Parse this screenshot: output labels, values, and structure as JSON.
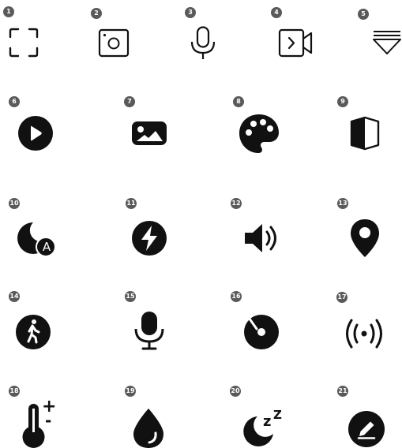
{
  "colors": {
    "icon": "#111111",
    "badge": "#5a5a5a",
    "background": "#ffffff"
  },
  "icons": [
    {
      "badge": "1",
      "name": "scan-frame-icon"
    },
    {
      "badge": "2",
      "name": "screenshot-camera-icon"
    },
    {
      "badge": "3",
      "name": "microphone-outline-icon"
    },
    {
      "badge": "4",
      "name": "screen-record-icon"
    },
    {
      "badge": "5",
      "name": "notification-shade-icon"
    },
    {
      "badge": "6",
      "name": "play-circle-icon"
    },
    {
      "badge": "7",
      "name": "image-icon"
    },
    {
      "badge": "8",
      "name": "palette-icon"
    },
    {
      "badge": "9",
      "name": "contrast-shield-icon"
    },
    {
      "badge": "10",
      "name": "auto-dark-mode-icon",
      "glyph": "A"
    },
    {
      "badge": "11",
      "name": "flash-circle-icon"
    },
    {
      "badge": "12",
      "name": "volume-icon"
    },
    {
      "badge": "13",
      "name": "location-pin-icon"
    },
    {
      "badge": "14",
      "name": "walking-person-icon"
    },
    {
      "badge": "15",
      "name": "microphone-icon"
    },
    {
      "badge": "16",
      "name": "music-disc-icon"
    },
    {
      "badge": "17",
      "name": "broadcast-signal-icon"
    },
    {
      "badge": "18",
      "name": "temperature-adjust-icon",
      "plus": "+",
      "minus": "-"
    },
    {
      "badge": "19",
      "name": "water-drop-icon"
    },
    {
      "badge": "20",
      "name": "sleep-moon-icon",
      "z_small": "z",
      "z_large": "Z"
    },
    {
      "badge": "21",
      "name": "edit-pencil-circle-icon"
    }
  ]
}
